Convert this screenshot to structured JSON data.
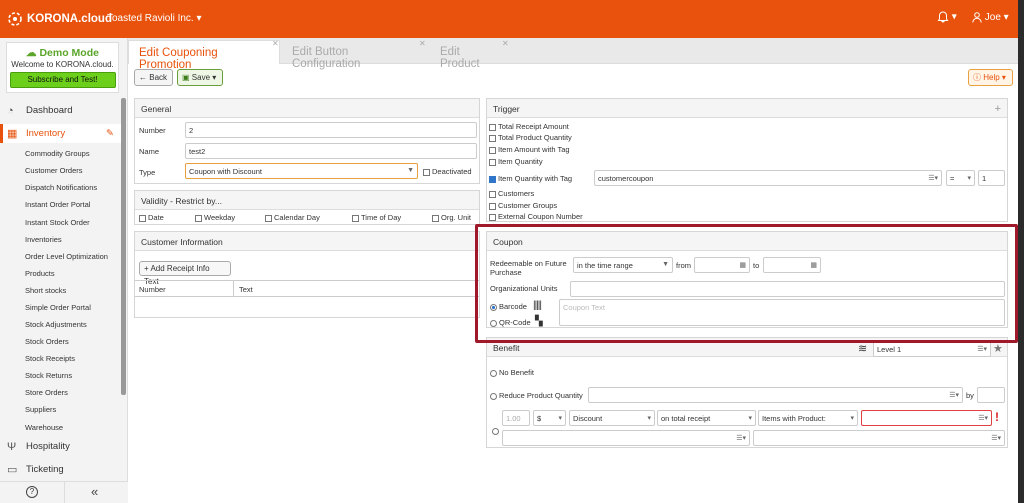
{
  "topbar": {
    "brand": "KORONA.cloud",
    "company": "Toasted Ravioli Inc. ▾",
    "bell": "▾",
    "user": "Joe ▾"
  },
  "sidebar": {
    "demo_title": "Demo Mode",
    "demo_sub": "Welcome to KORONA.cloud.",
    "demo_btn": "Subscribe and Test!",
    "dashboard": "Dashboard",
    "inventory": "Inventory",
    "hospitality": "Hospitality",
    "ticketing": "Ticketing",
    "items": [
      "Commodity Groups",
      "Customer Orders",
      "Dispatch Notifications",
      "Instant Order Portal",
      "Instant Stock Order",
      "Inventories",
      "Order Level Optimization",
      "Products",
      "Short stocks",
      "Simple Order Portal",
      "Stock Adjustments",
      "Stock Orders",
      "Stock Receipts",
      "Stock Returns",
      "Store Orders",
      "Suppliers",
      "Warehouse"
    ],
    "help_icon": "?",
    "collapse": "«"
  },
  "tabs": [
    "Edit Couponing Promotion",
    "Edit Button Configuration",
    "Edit Product"
  ],
  "toolbar": {
    "back": "Back",
    "save": "Save",
    "help": "Help"
  },
  "general": {
    "title": "General",
    "number_label": "Number",
    "number": "2",
    "name_label": "Name",
    "name": "test2",
    "type_label": "Type",
    "type": "Coupon with Discount",
    "deactivated": "Deactivated"
  },
  "validity": {
    "title": "Validity - Restrict by...",
    "opts": [
      "Date",
      "Weekday",
      "Calendar Day",
      "Time of Day",
      "Org. Unit"
    ]
  },
  "customer": {
    "title": "Customer Information",
    "add": "+ Add Receipt Info Text",
    "cols": [
      "Number",
      "Text"
    ]
  },
  "trigger": {
    "title": "Trigger",
    "plus": "+",
    "opts": [
      "Total Receipt Amount",
      "Total Product Quantity",
      "Item Amount with Tag",
      "Item Quantity",
      "Item Quantity with Tag",
      "Customers",
      "Customer Groups",
      "External Coupon Number"
    ],
    "tag": "customercoupon",
    "op": "=",
    "qty": "1"
  },
  "coupon": {
    "title": "Coupon",
    "redeem_label": "Redeemable on Future Purchase",
    "redeem": "in the time range",
    "from": "from",
    "to": "to",
    "org_label": "Organizational Units",
    "barcode": "Barcode",
    "qr": "QR-Code",
    "text_placeholder": "Coupon Text"
  },
  "benefit": {
    "title": "Benefit",
    "level": "Level 1",
    "no_benefit": "No Benefit",
    "reduce": "Reduce Product Quantity",
    "by": "by",
    "amount": "1.00",
    "currency": "$",
    "discount": "Discount",
    "scope": "on total receipt",
    "items": "Items with Product:",
    "error": "!"
  },
  "colors": {
    "brand": "#e8520c",
    "highlight": "#a0192b",
    "green": "#6bcf1c"
  }
}
